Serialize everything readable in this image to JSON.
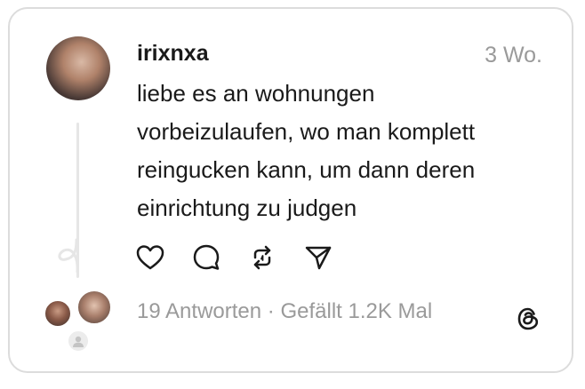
{
  "post": {
    "username": "irixnxa",
    "time": "3 Wo.",
    "text_lines": [
      "liebe es an wohnungen",
      "vorbeizulaufen, wo man komplett",
      "reingucken kann, um dann deren",
      "einrichtung zu judgen"
    ]
  },
  "actions": {
    "like_icon": "heart-icon",
    "comment_icon": "comment-icon",
    "repost_icon": "repost-icon",
    "share_icon": "send-icon"
  },
  "footer": {
    "replies": "19 Antworten",
    "separator": "·",
    "likes": "Gefällt 1.2K Mal"
  },
  "brand": {
    "logo_icon": "threads-logo-icon",
    "text_color": "#1a1a1a",
    "muted_color": "#9a9a9a"
  }
}
